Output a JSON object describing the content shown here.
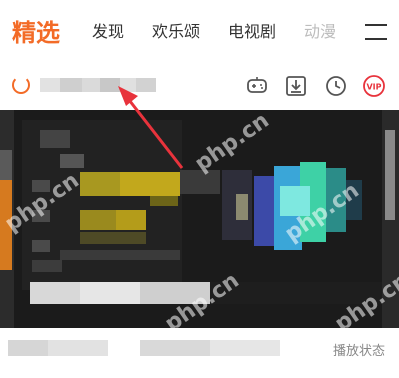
{
  "tabs": [
    {
      "label": "精选",
      "active": true
    },
    {
      "label": "发现",
      "active": false
    },
    {
      "label": "欢乐颂",
      "active": false
    },
    {
      "label": "电视剧",
      "active": false
    },
    {
      "label": "动漫",
      "active": false
    }
  ],
  "menu_icon": "hamburger-menu-icon",
  "search": {
    "icon": "search-spinner-icon",
    "placeholder": ""
  },
  "toolbar_icons": [
    "game-controller-icon",
    "download-icon",
    "history-clock-icon",
    "vip-icon"
  ],
  "toolbar_vip_label": "VIP",
  "colors": {
    "accent": "#f36b27",
    "vip": "#e8333c",
    "arrow": "#e8333c",
    "banner_bg": "#1b1b1b"
  },
  "caption": {
    "right_text": "播放状态"
  },
  "watermark": "php.cn"
}
